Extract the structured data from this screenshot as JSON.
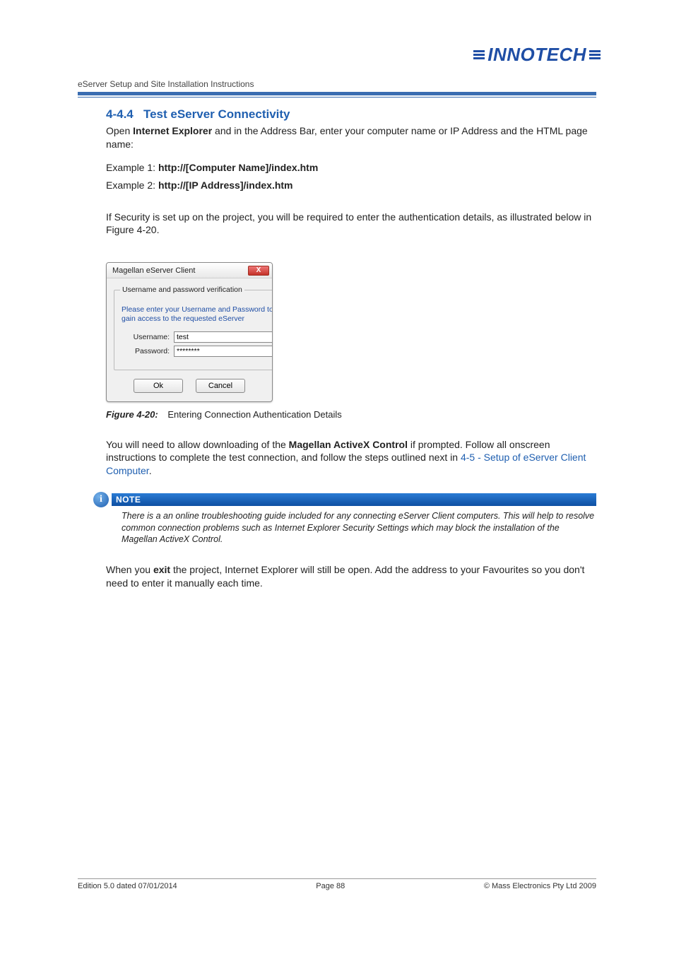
{
  "brand": "INNOTECH",
  "doc_title": "eServer Setup and Site Installation Instructions",
  "section": {
    "number": "4-4.4",
    "title": "Test eServer Connectivity"
  },
  "intro": {
    "pre": "Open ",
    "bold": "Internet Explorer",
    "post": " and in the Address Bar, enter your computer name or IP Address and the HTML page name:"
  },
  "examples": {
    "e1_label": "Example 1: ",
    "e1_val": "http://[Computer Name]/index.htm",
    "e2_label": "Example 2: ",
    "e2_val": "http://[IP Address]/index.htm"
  },
  "security_note": "If Security is set up on the project, you will be required to enter the authentication details, as illustrated below in Figure 4-20.",
  "dialog": {
    "title": "Magellan eServer Client",
    "close_glyph": "X",
    "legend": "Username and password verification",
    "message": "Please enter your Username and Password to gain access to the requested eServer",
    "username_label": "Username:",
    "username_value": "test",
    "password_label": "Password:",
    "password_value": "********",
    "ok": "Ok",
    "cancel": "Cancel"
  },
  "figure": {
    "label": "Figure 4-20:",
    "caption": "Entering Connection Authentication Details"
  },
  "para_activex": {
    "pre": "You will need to allow downloading of the ",
    "bold": "Magellan ActiveX Control",
    "mid": " if prompted.  Follow all onscreen instructions to complete the test connection, and follow the steps outlined next in ",
    "link": "4-5 - Setup of eServer Client Computer",
    "post": "."
  },
  "note": {
    "icon": "i",
    "label": "NOTE",
    "text": "There is a an online troubleshooting guide included for any connecting eServer Client computers.  This will help to resolve common connection problems such as Internet Explorer Security Settings which may block the installation of the Magellan ActiveX Control."
  },
  "para_exit": {
    "pre": "When you ",
    "bold": "exit",
    "post": " the project, Internet Explorer will still be open.  Add the address to your Favourites so you don't need to enter it manually each time."
  },
  "footer": {
    "left": "Edition 5.0 dated 07/01/2014",
    "center": "Page 88",
    "right": "©  Mass Electronics Pty Ltd  2009"
  }
}
